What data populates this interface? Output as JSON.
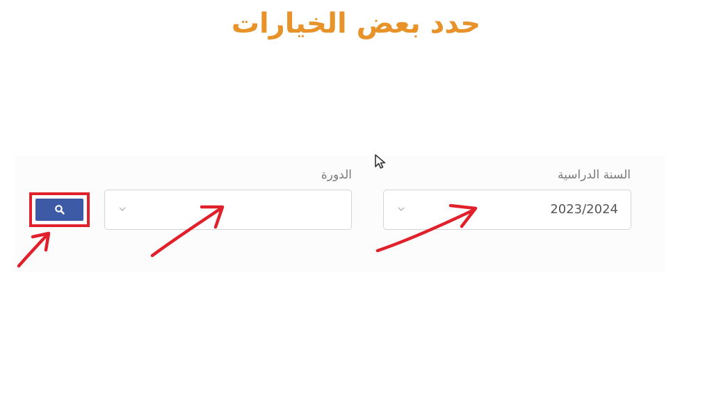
{
  "headline": "حدد بعض الخيارات",
  "form": {
    "academic_year": {
      "label": "السنة الدراسية",
      "selected_value": "2023/2024"
    },
    "session": {
      "label": "الدورة",
      "selected_value": ""
    },
    "search_button_icon": "search-icon"
  },
  "colors": {
    "headline": "#e8922a",
    "annotation_red": "#e0202a",
    "button_blue": "#3c5aa6"
  },
  "annotations": [
    "arrow-to-academic-year",
    "arrow-to-session",
    "arrow-to-search-button"
  ]
}
